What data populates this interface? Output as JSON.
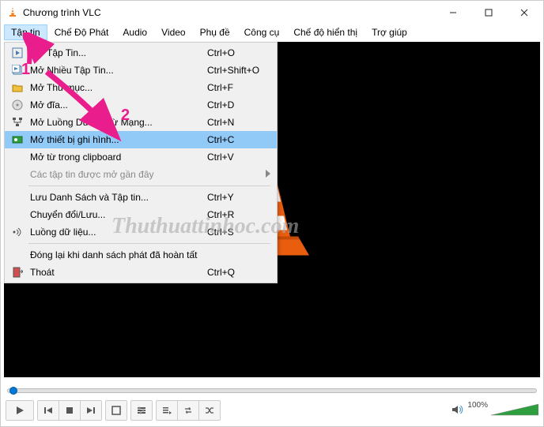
{
  "window": {
    "title": "Chương trình VLC"
  },
  "menubar": {
    "items": [
      "Tập tin",
      "Chế Độ Phát",
      "Audio",
      "Video",
      "Phụ đề",
      "Công cụ",
      "Chế độ hiển thị",
      "Trợ giúp"
    ],
    "open_index": 0
  },
  "dropdown": {
    "items": [
      {
        "icon": "play-file",
        "label": "Mở Tập Tin...",
        "shortcut": "Ctrl+O"
      },
      {
        "icon": "play-files",
        "label": "Mở Nhiều Tập Tin...",
        "shortcut": "Ctrl+Shift+O"
      },
      {
        "icon": "folder",
        "label": "Mở Thư mục...",
        "shortcut": "Ctrl+F"
      },
      {
        "icon": "disc",
        "label": "Mở đĩa...",
        "shortcut": "Ctrl+D"
      },
      {
        "icon": "network",
        "label": "Mở Luồng Dữ liệu từ Mạng...",
        "shortcut": "Ctrl+N"
      },
      {
        "icon": "capture",
        "label": "Mở thiết bị ghi hình...",
        "shortcut": "Ctrl+C",
        "highlight": true
      },
      {
        "icon": "",
        "label": "Mở từ trong clipboard",
        "shortcut": "Ctrl+V"
      },
      {
        "icon": "",
        "label": "Các tập tin được mở gần đây",
        "shortcut": "",
        "disabled": true,
        "submenu": true
      },
      {
        "sep": true
      },
      {
        "icon": "",
        "label": "Lưu Danh Sách và Tập tin...",
        "shortcut": "Ctrl+Y"
      },
      {
        "icon": "",
        "label": "Chuyển đổi/Lưu...",
        "shortcut": "Ctrl+R"
      },
      {
        "icon": "stream",
        "label": "Luồng dữ liệu...",
        "shortcut": "Ctrl+S"
      },
      {
        "sep": true
      },
      {
        "icon": "",
        "label": "Đóng lại khi danh sách phát đã hoàn tất",
        "shortcut": ""
      },
      {
        "icon": "quit",
        "label": "Thoát",
        "shortcut": "Ctrl+Q"
      }
    ]
  },
  "volume": {
    "percent_label": "100%"
  },
  "annotations": {
    "one": "1",
    "two": "2"
  },
  "watermark": "Thuthuattinhoc.com"
}
